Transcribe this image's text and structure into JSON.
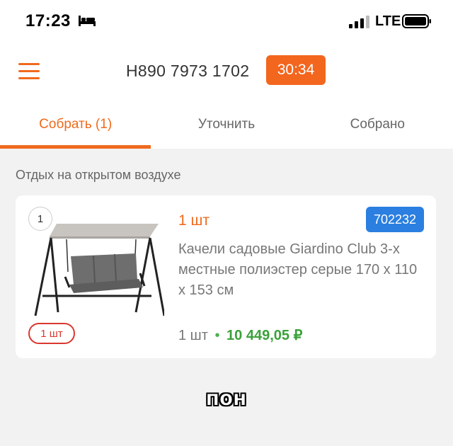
{
  "status_bar": {
    "time": "17:23",
    "network": "LTE",
    "icons": [
      "bed-icon",
      "signal-icon",
      "battery-icon"
    ]
  },
  "header": {
    "order_number": "Н890 7973 1702",
    "timer": "30:34",
    "accent_color": "#f3661e"
  },
  "tabs": [
    {
      "label": "Собрать (1)",
      "active": true
    },
    {
      "label": "Уточнить",
      "active": false
    },
    {
      "label": "Собрано",
      "active": false
    }
  ],
  "section": {
    "title": "Отдых на открытом воздухе"
  },
  "item": {
    "position": "1",
    "qty_pill": "1 шт",
    "qty": "1 шт",
    "sku": "702232",
    "title": "Качели садовые Giardino Club 3-х местные полиэстер серые 170 х 110 х 153 см",
    "price_qty": "1 шт",
    "price_separator": "•",
    "price": "10 449,05 ₽",
    "price_color": "#3aa13a",
    "sku_color": "#2a7fe0"
  },
  "caption": "пон"
}
